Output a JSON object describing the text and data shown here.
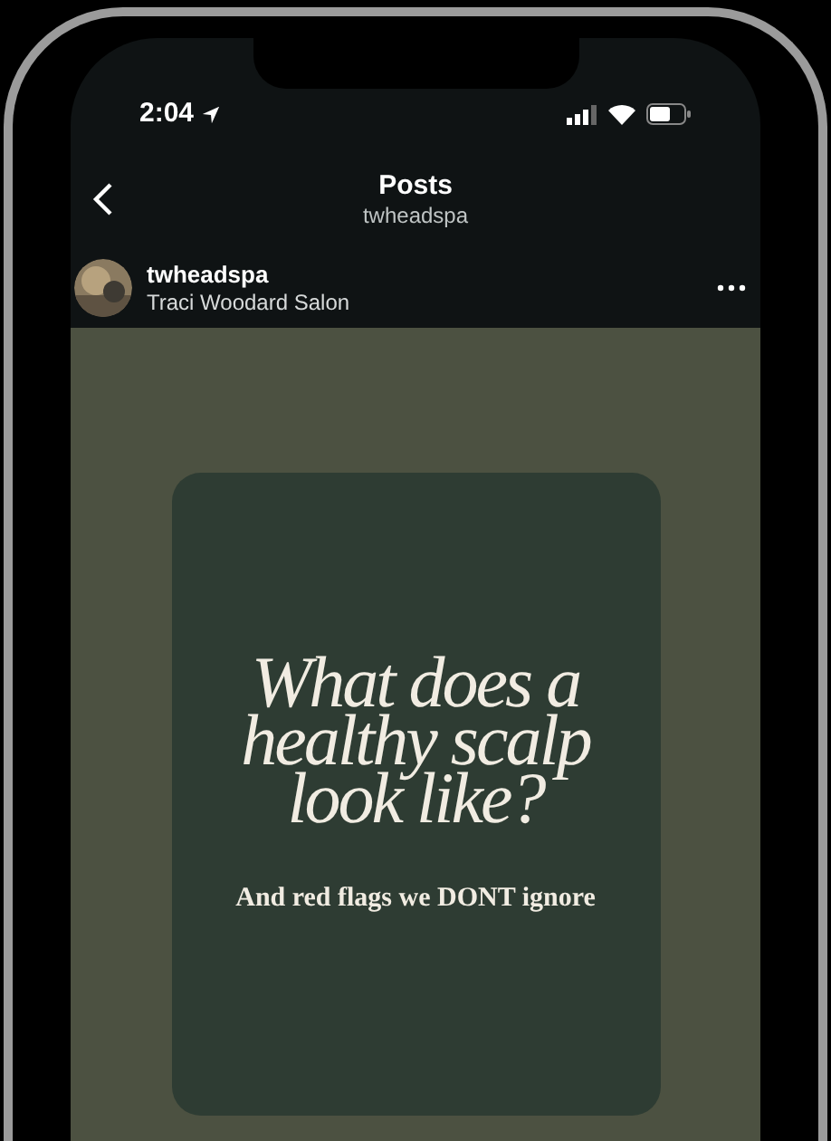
{
  "status_bar": {
    "time": "2:04"
  },
  "header": {
    "title": "Posts",
    "subtitle": "twheadspa"
  },
  "post_author": {
    "username": "twheadspa",
    "location": "Traci Woodard Salon"
  },
  "post": {
    "headline": "What does a healthy scalp look like?",
    "subline": "And red flags we DONT ignore"
  }
}
